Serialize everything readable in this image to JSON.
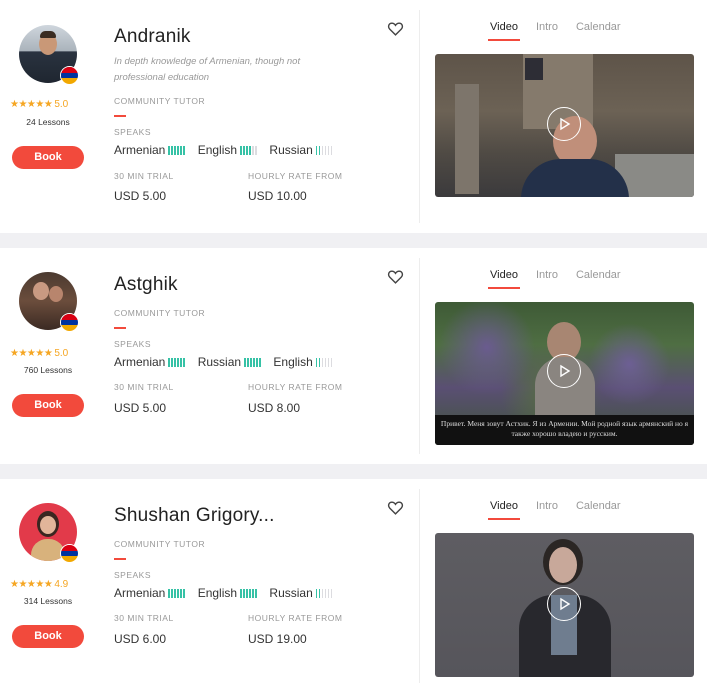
{
  "common": {
    "book_label": "Book",
    "speaks_label": "SPEAKS",
    "trial_label": "30 MIN TRIAL",
    "rate_label": "HOURLY RATE FROM",
    "tabs": [
      "Video",
      "Intro",
      "Calendar"
    ],
    "accent_color": "#f24a3c",
    "star_color": "#f5a623",
    "level_color": "#36c2a6"
  },
  "tutors": [
    {
      "name": "Andranik",
      "description": "In depth knowledge of Armenian, though not professional education",
      "role": "COMMUNITY TUTOR",
      "stars": "★★★★★",
      "rating": "5.0",
      "lessons": "24 Lessons",
      "languages": [
        {
          "name": "Armenian",
          "level": 0
        },
        {
          "name": "English",
          "level": 4
        },
        {
          "name": "Russian",
          "level": 0
        }
      ],
      "trial_price": "USD 5.00",
      "hourly_price": "USD 10.00",
      "video_caption": ""
    },
    {
      "name": "Astghik",
      "description": "",
      "role": "COMMUNITY TUTOR",
      "stars": "★★★★★",
      "rating": "5.0",
      "lessons": "760 Lessons",
      "languages": [
        {
          "name": "Armenian",
          "level": 0
        },
        {
          "name": "Russian",
          "level": 6
        },
        {
          "name": "English",
          "level": 0
        }
      ],
      "trial_price": "USD 5.00",
      "hourly_price": "USD 8.00",
      "video_caption": "Привет. Меня зовут Астхик. Я из Армении. Мой родной язык армянский но я также хорошо владею и русским."
    },
    {
      "name": "Shushan Grigory...",
      "description": "",
      "role": "COMMUNITY TUTOR",
      "stars": "★★★★★",
      "rating": "4.9",
      "lessons": "314 Lessons",
      "languages": [
        {
          "name": "Armenian",
          "level": 0
        },
        {
          "name": "English",
          "level": 6
        },
        {
          "name": "Russian",
          "level": 0
        }
      ],
      "trial_price": "USD 6.00",
      "hourly_price": "USD 19.00",
      "video_caption": ""
    }
  ]
}
